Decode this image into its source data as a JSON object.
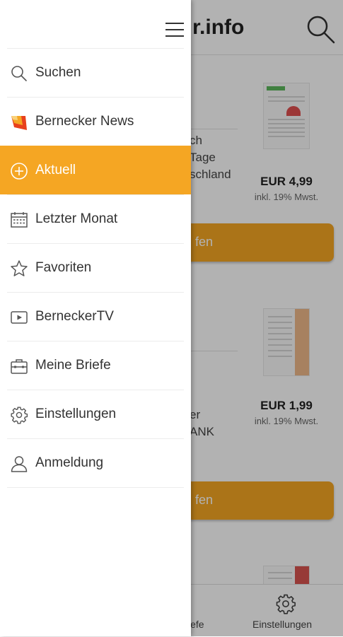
{
  "app": {
    "title_fragment": "r.info",
    "cards": [
      {
        "text_lines": [
          "ch",
          "Tage",
          "schland"
        ],
        "price": "EUR 4,99",
        "vat": "inkl. 19% Mwst.",
        "button_fragment": "fen"
      },
      {
        "text_lines": [
          "er",
          "ANK"
        ],
        "price": "EUR 1,99",
        "vat": "inkl. 19% Mwst.",
        "button_fragment": "fen"
      }
    ],
    "bottom_nav": {
      "left_fragment": "iefe",
      "settings_label": "Einstellungen"
    },
    "accent_color": "#f5a623"
  },
  "drawer": {
    "items": [
      {
        "label": "Suchen",
        "icon": "search-icon"
      },
      {
        "label": "Bernecker News",
        "icon": "news-logo-icon"
      },
      {
        "label": "Aktuell",
        "icon": "plus-circle-icon",
        "active": true
      },
      {
        "label": "Letzter Monat",
        "icon": "calendar-icon"
      },
      {
        "label": "Favoriten",
        "icon": "star-icon"
      },
      {
        "label": "BerneckerTV",
        "icon": "video-play-icon"
      },
      {
        "label": "Meine Briefe",
        "icon": "briefcase-icon"
      },
      {
        "label": "Einstellungen",
        "icon": "gear-icon"
      },
      {
        "label": "Anmeldung",
        "icon": "user-icon"
      }
    ]
  }
}
